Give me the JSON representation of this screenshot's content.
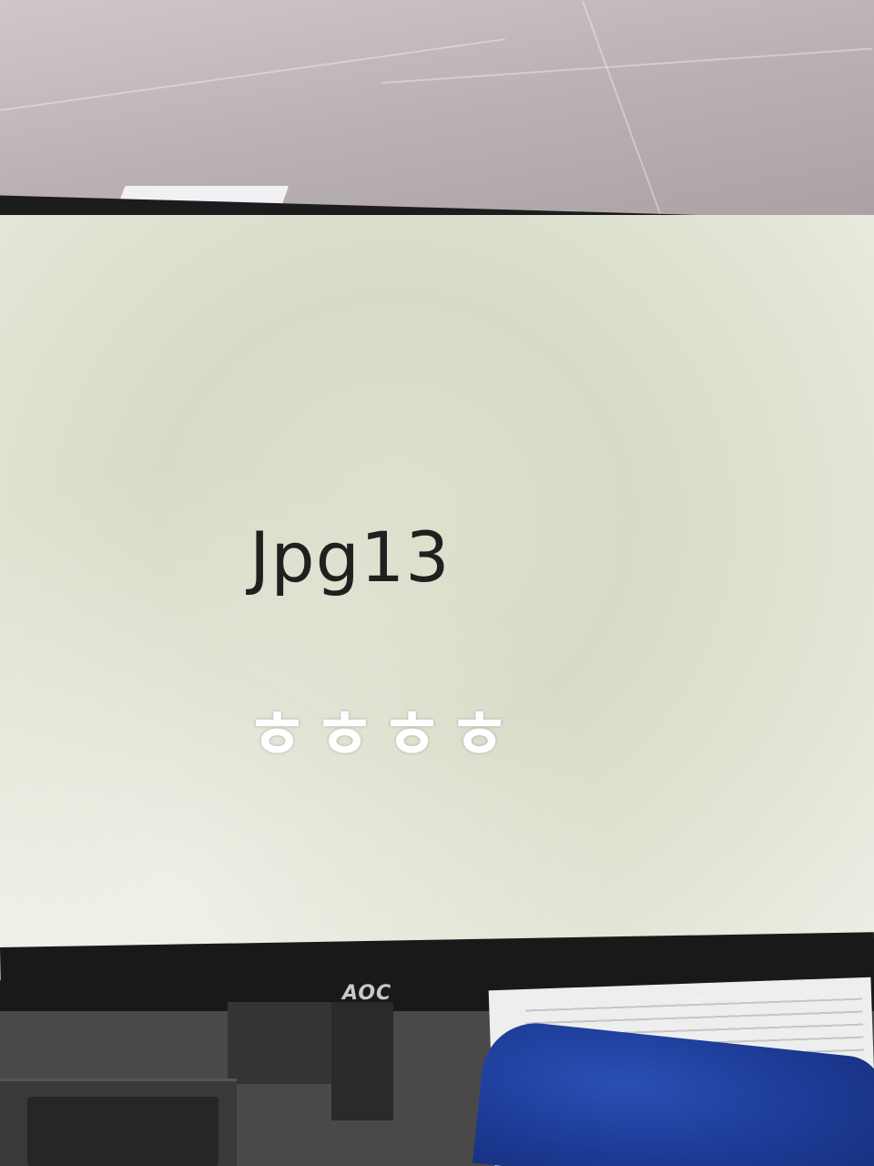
{
  "screen": {
    "title": "Jpg13",
    "caption": "ㅎㅎㅎㅎ"
  },
  "monitor": {
    "brand": "AOC"
  },
  "colors": {
    "screen_background": "#dfe1cf",
    "title_text": "#202020",
    "caption_text": "#ffffff",
    "bezel": "#1d1c1d",
    "pouch": "#1c3a94"
  }
}
